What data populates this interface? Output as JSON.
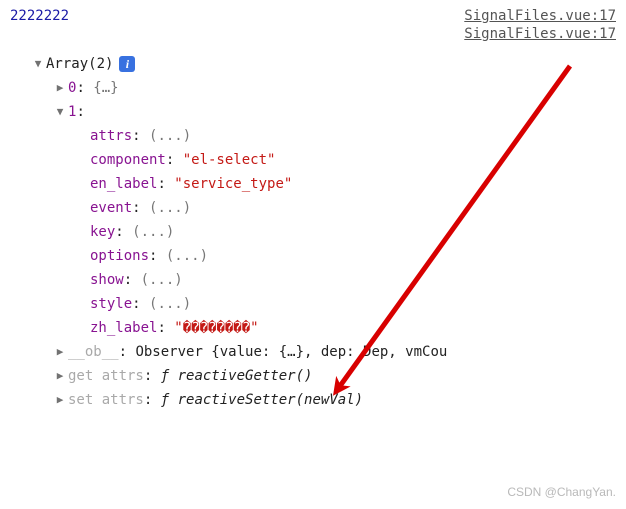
{
  "logTop": {
    "message": "2222222",
    "source1": "SignalFiles.vue:17",
    "source2": "SignalFiles.vue:17"
  },
  "arrayHeader": "Array(2)",
  "infoGlyph": "i",
  "item0": {
    "key": "0",
    "preview": "{…}"
  },
  "item1": {
    "key": "1",
    "props": {
      "attrs": {
        "name": "attrs",
        "value": "(...)"
      },
      "component": {
        "name": "component",
        "value": "\"el-select\""
      },
      "en_label": {
        "name": "en_label",
        "value": "\"service_type\""
      },
      "event": {
        "name": "event",
        "value": "(...)"
      },
      "key": {
        "name": "key",
        "value": "(...)"
      },
      "options": {
        "name": "options",
        "value": "(...)"
      },
      "show": {
        "name": "show",
        "value": "(...)"
      },
      "style": {
        "name": "style",
        "value": "(...)"
      },
      "zh_label": {
        "name": "zh_label",
        "value": "\"��������\""
      }
    },
    "ob": {
      "name": "__ob__",
      "preview": "Observer {value: {…}, dep: Dep, vmCou"
    },
    "getter": {
      "prefix": "get ",
      "name": "attrs",
      "fn": "ƒ reactiveGetter()"
    },
    "setter": {
      "prefix": "set ",
      "name": "attrs",
      "fn": "ƒ reactiveSetter(newVal)"
    }
  },
  "watermark": "CSDN @ChangYan."
}
